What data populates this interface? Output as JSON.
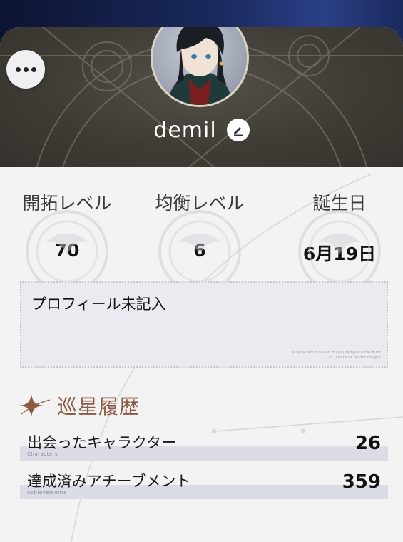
{
  "profile": {
    "username": "demil",
    "more_icon": "more-horizontal-icon",
    "edit_icon": "pencil-icon"
  },
  "stats": [
    {
      "label": "開拓レベル",
      "value": "70"
    },
    {
      "label": "均衡レベル",
      "value": "6"
    },
    {
      "label": "誕生日",
      "value": "6月19日"
    }
  ],
  "signature": {
    "text": "プロフィール未記入",
    "fine_print": "aliquaenim nisi sed do eiu tempor incididunt ut labore et dolore magna"
  },
  "history": {
    "title": "巡星履歴",
    "icon": "sparkle-star-icon",
    "rows": [
      {
        "label": "出会ったキャラクター",
        "sub": "Characters",
        "value": "26"
      },
      {
        "label": "達成済みアチーブメント",
        "sub": "Achievements",
        "value": "359"
      }
    ]
  },
  "colors": {
    "header_bg": "#3f3c35",
    "card_bg": "#f3f3f4",
    "accent_title": "#8c5a45",
    "row_bar": "#dcdce6"
  }
}
